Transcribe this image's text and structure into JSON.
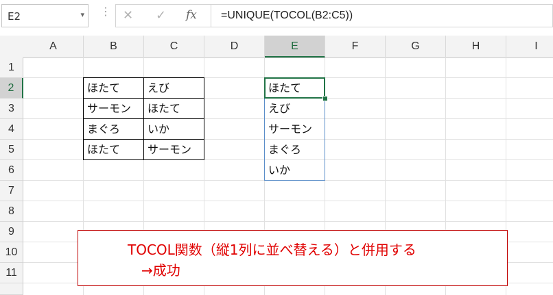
{
  "formula_bar": {
    "name_box": "E2",
    "name_box_arrow": "▾",
    "dots": "⋮",
    "cancel_icon": "✕",
    "enter_icon": "✓",
    "fx_label": "fx",
    "formula": "=UNIQUE(TOCOL(B2:C5))"
  },
  "columns": [
    "A",
    "B",
    "C",
    "D",
    "E",
    "F",
    "G",
    "H",
    "I"
  ],
  "selected_column": "E",
  "rows": [
    "1",
    "2",
    "3",
    "4",
    "5",
    "6",
    "7",
    "8",
    "9",
    "10",
    "11"
  ],
  "selected_row": "2",
  "source_table": [
    [
      "ほたて",
      "えび"
    ],
    [
      "サーモン",
      "ほたて"
    ],
    [
      "まぐろ",
      "いか"
    ],
    [
      "ほたて",
      "サーモン"
    ]
  ],
  "result_column": [
    "ほたて",
    "えび",
    "サーモン",
    "まぐろ",
    "いか"
  ],
  "note": {
    "line1": "TOCOL関数（縦1列に並べ替える）と併用する",
    "line2": "→成功"
  },
  "colors": {
    "accent": "#217346",
    "note_text": "#e00000",
    "note_border": "#c00000",
    "spill_border": "#5b8ec9"
  }
}
